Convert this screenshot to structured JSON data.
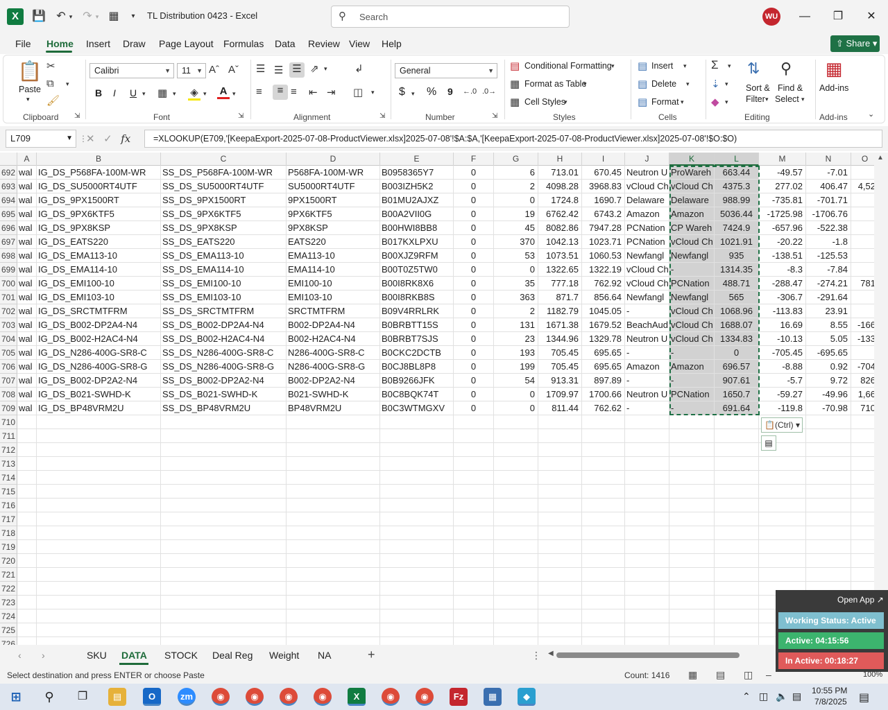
{
  "window": {
    "title": "TL Distribution 0423  -  Excel",
    "search_placeholder": "Search",
    "user_initials": "WU",
    "app_letter": "X"
  },
  "menu": {
    "tabs": [
      "File",
      "Home",
      "Insert",
      "Draw",
      "Page Layout",
      "Formulas",
      "Data",
      "Review",
      "View",
      "Help"
    ],
    "share": "Share"
  },
  "ribbon": {
    "paste": "Paste",
    "clipboard": "Clipboard",
    "font_name": "Calibri",
    "font_size": "11",
    "font": "Font",
    "alignment": "Alignment",
    "number_format": "General",
    "number": "Number",
    "conditional": "Conditional Formatting",
    "format_table": "Format as Table",
    "cell_styles": "Cell Styles",
    "styles": "Styles",
    "insert": "Insert",
    "delete": "Delete",
    "format": "Format",
    "cells": "Cells",
    "sort_filter_1": "Sort &",
    "sort_filter_2": "Filter",
    "find_select_1": "Find &",
    "find_select_2": "Select",
    "editing": "Editing",
    "addins_btn": "Add-ins",
    "addins": "Add-ins",
    "bold": "B",
    "italic": "I",
    "underline": "U",
    "currency": "$",
    "percent": "%",
    "comma": "9"
  },
  "formula_bar": {
    "name_box": "L709",
    "fx": "fx",
    "formula": "=XLOOKUP(E709,'[KeepaExport-2025-07-08-ProductViewer.xlsx]2025-07-08'!$A:$A,'[KeepaExport-2025-07-08-ProductViewer.xlsx]2025-07-08'!$O:$O)"
  },
  "sheet": {
    "columns": [
      "A",
      "B",
      "C",
      "D",
      "E",
      "F",
      "G",
      "H",
      "I",
      "J",
      "K",
      "L",
      "M",
      "N",
      "O"
    ],
    "rows": [
      {
        "n": "692",
        "cells": [
          "wal",
          "IG_DS_P568FA-100M-WR",
          "SS_DS_P568FA-100M-WR",
          "P568FA-100M-WR",
          "B0958365Y7",
          "0",
          "6",
          "713.01",
          "670.45",
          "Neutron U",
          "ProWareh",
          "663.44",
          "-49.57",
          "-7.01",
          ""
        ]
      },
      {
        "n": "693",
        "cells": [
          "wal",
          "IG_DS_SU5000RT4UTF",
          "SS_DS_SU5000RT4UTF",
          "SU5000RT4UTF",
          "B003IZH5K2",
          "0",
          "2",
          "4098.28",
          "3968.83",
          "vCloud Ch",
          "vCloud Ch",
          "4375.3",
          "277.02",
          "406.47",
          "4,52"
        ]
      },
      {
        "n": "694",
        "cells": [
          "wal",
          "IG_DS_9PX1500RT",
          "SS_DS_9PX1500RT",
          "9PX1500RT",
          "B01MU2AJXZ",
          "0",
          "0",
          "1724.8",
          "1690.7",
          "Delaware",
          "Delaware",
          "988.99",
          "-735.81",
          "-701.71",
          ""
        ]
      },
      {
        "n": "695",
        "cells": [
          "wal",
          "IG_DS_9PX6KTF5",
          "SS_DS_9PX6KTF5",
          "9PX6KTF5",
          "B00A2VII0G",
          "0",
          "19",
          "6762.42",
          "6743.2",
          "Amazon",
          "Amazon",
          "5036.44",
          "-1725.98",
          "-1706.76",
          ""
        ]
      },
      {
        "n": "696",
        "cells": [
          "wal",
          "IG_DS_9PX8KSP",
          "SS_DS_9PX8KSP",
          "9PX8KSP",
          "B00HWI8BB8",
          "0",
          "45",
          "8082.86",
          "7947.28",
          "PCNation",
          "CP Wareh",
          "7424.9",
          "-657.96",
          "-522.38",
          ""
        ]
      },
      {
        "n": "697",
        "cells": [
          "wal",
          "IG_DS_EATS220",
          "SS_DS_EATS220",
          "EATS220",
          "B017KXLPXU",
          "0",
          "370",
          "1042.13",
          "1023.71",
          "PCNation",
          "vCloud Ch",
          "1021.91",
          "-20.22",
          "-1.8",
          ""
        ]
      },
      {
        "n": "698",
        "cells": [
          "wal",
          "IG_DS_EMA113-10",
          "SS_DS_EMA113-10",
          "EMA113-10",
          "B00XJZ9RFM",
          "0",
          "53",
          "1073.51",
          "1060.53",
          "Newfangl",
          "Newfangl",
          "935",
          "-138.51",
          "-125.53",
          ""
        ]
      },
      {
        "n": "699",
        "cells": [
          "wal",
          "IG_DS_EMA114-10",
          "SS_DS_EMA114-10",
          "EMA114-10",
          "B00T0Z5TW0",
          "0",
          "0",
          "1322.65",
          "1322.19",
          "vCloud Ch",
          "-",
          "1314.35",
          "-8.3",
          "-7.84",
          ""
        ]
      },
      {
        "n": "700",
        "cells": [
          "wal",
          "IG_DS_EMI100-10",
          "SS_DS_EMI100-10",
          "EMI100-10",
          "B00I8RK8X6",
          "0",
          "35",
          "777.18",
          "762.92",
          "vCloud Ch",
          "PCNation",
          "488.71",
          "-288.47",
          "-274.21",
          "781"
        ]
      },
      {
        "n": "701",
        "cells": [
          "wal",
          "IG_DS_EMI103-10",
          "SS_DS_EMI103-10",
          "EMI103-10",
          "B00I8RKB8S",
          "0",
          "363",
          "871.7",
          "856.64",
          "Newfangl",
          "Newfangl",
          "565",
          "-306.7",
          "-291.64",
          ""
        ]
      },
      {
        "n": "702",
        "cells": [
          "wal",
          "IG_DS_SRCTMTFRM",
          "SS_DS_SRCTMTFRM",
          "SRCTMTFRM",
          "B09V4RRLRK",
          "0",
          "2",
          "1182.79",
          "1045.05",
          "-",
          "vCloud Ch",
          "1068.96",
          "-113.83",
          "23.91",
          ""
        ]
      },
      {
        "n": "703",
        "cells": [
          "wal",
          "IG_DS_B002-DP2A4-N4",
          "SS_DS_B002-DP2A4-N4",
          "B002-DP2A4-N4",
          "B0BRBTT15S",
          "0",
          "131",
          "1671.38",
          "1679.52",
          "BeachAud",
          "vCloud Ch",
          "1688.07",
          "16.69",
          "8.55",
          "-166"
        ]
      },
      {
        "n": "704",
        "cells": [
          "wal",
          "IG_DS_B002-H2AC4-N4",
          "SS_DS_B002-H2AC4-N4",
          "B002-H2AC4-N4",
          "B0BRBT7SJS",
          "0",
          "23",
          "1344.96",
          "1329.78",
          "Neutron U",
          "vCloud Ch",
          "1334.83",
          "-10.13",
          "5.05",
          "-133"
        ]
      },
      {
        "n": "705",
        "cells": [
          "wal",
          "IG_DS_N286-400G-SR8-C",
          "SS_DS_N286-400G-SR8-C",
          "N286-400G-SR8-C",
          "B0CKC2DCTB",
          "0",
          "193",
          "705.45",
          "695.65",
          "-",
          "-",
          "0",
          "-705.45",
          "-695.65",
          ""
        ]
      },
      {
        "n": "706",
        "cells": [
          "wal",
          "IG_DS_N286-400G-SR8-G",
          "SS_DS_N286-400G-SR8-G",
          "N286-400G-SR8-G",
          "B0CJ8BL8P8",
          "0",
          "199",
          "705.45",
          "695.65",
          "Amazon",
          "Amazon",
          "696.57",
          "-8.88",
          "0.92",
          "-704"
        ]
      },
      {
        "n": "707",
        "cells": [
          "wal",
          "IG_DS_B002-DP2A2-N4",
          "SS_DS_B002-DP2A2-N4",
          "B002-DP2A2-N4",
          "B0B9266JFK",
          "0",
          "54",
          "913.31",
          "897.89",
          "-",
          "-",
          "907.61",
          "-5.7",
          "9.72",
          "826"
        ]
      },
      {
        "n": "708",
        "cells": [
          "wal",
          "IG_DS_B021-SWHD-K",
          "SS_DS_B021-SWHD-K",
          "B021-SWHD-K",
          "B0C8BQK74T",
          "0",
          "0",
          "1709.97",
          "1700.66",
          "Neutron U",
          "PCNation",
          "1650.7",
          "-59.27",
          "-49.96",
          "1,66"
        ]
      },
      {
        "n": "709",
        "cells": [
          "wal",
          "IG_DS_BP48VRM2U",
          "SS_DS_BP48VRM2U",
          "BP48VRM2U",
          "B0C3WTMGXV",
          "0",
          "0",
          "811.44",
          "762.62",
          "-",
          "-",
          "691.64",
          "-119.8",
          "-70.98",
          "710"
        ]
      }
    ],
    "empty_rows": [
      "710",
      "711",
      "712",
      "713",
      "714",
      "715",
      "716",
      "717",
      "718",
      "719",
      "720",
      "721",
      "722",
      "723",
      "724",
      "725",
      "726"
    ],
    "paste_options": "(Ctrl)"
  },
  "sheet_tabs": [
    "SKU",
    "DATA",
    "STOCK",
    "Deal Reg",
    "Weight",
    "NA"
  ],
  "active_sheet": "DATA",
  "status": {
    "message": "Select destination and press ENTER or choose Paste",
    "count": "Count: 1416",
    "zoom": "100%"
  },
  "widget": {
    "open_app": "Open App ↗",
    "working_status": "Working Status: Active",
    "active": "Active: 04:15:56",
    "inactive": "In Active: 00:18:27"
  },
  "taskbar": {
    "time": "10:55 PM",
    "date": "7/8/2025"
  },
  "colors": {
    "excel_green": "#1e7145",
    "selection_gray": "#d2d2d2",
    "avatar_red": "#c4262e"
  }
}
